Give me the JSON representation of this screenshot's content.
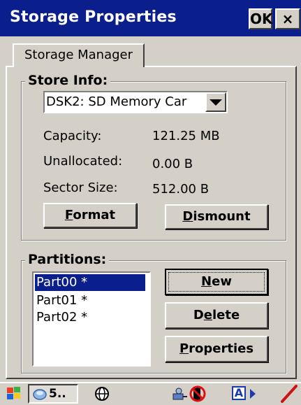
{
  "window": {
    "title": "Storage Properties",
    "ok_label": "OK",
    "close_label": "×"
  },
  "tabs": [
    {
      "label": "Storage Manager"
    }
  ],
  "store_info": {
    "label": "Store Info:",
    "store_selected": "DSK2: SD Memory Car",
    "rows": [
      {
        "label": "Capacity:",
        "value": "121.25 MB"
      },
      {
        "label": "Unallocated:",
        "value": "0.00 B"
      },
      {
        "label": "Sector Size:",
        "value": "512.00 B"
      }
    ],
    "format_label": {
      "mnemonic": "F",
      "rest": "ormat"
    },
    "dismount_label": {
      "mnemonic": "D",
      "rest": "ismount"
    }
  },
  "partitions": {
    "label": "Partitions:",
    "items": [
      "Part00 *",
      "Part01 *",
      "Part02 *"
    ],
    "selected_index": 0,
    "new_label": {
      "mnemonic": "N",
      "rest": "ew"
    },
    "delete_label": {
      "pre": "D",
      "mnemonic": "e",
      "rest": "lete"
    },
    "properties_label": {
      "mnemonic": "P",
      "rest": "roperties"
    }
  },
  "taskbar": {
    "task_label": "5..",
    "input_indicator": "A"
  },
  "colors": {
    "title_bar": "#0a1e8c",
    "face": "#d4d0c8",
    "selection": "#0a1e8c"
  }
}
